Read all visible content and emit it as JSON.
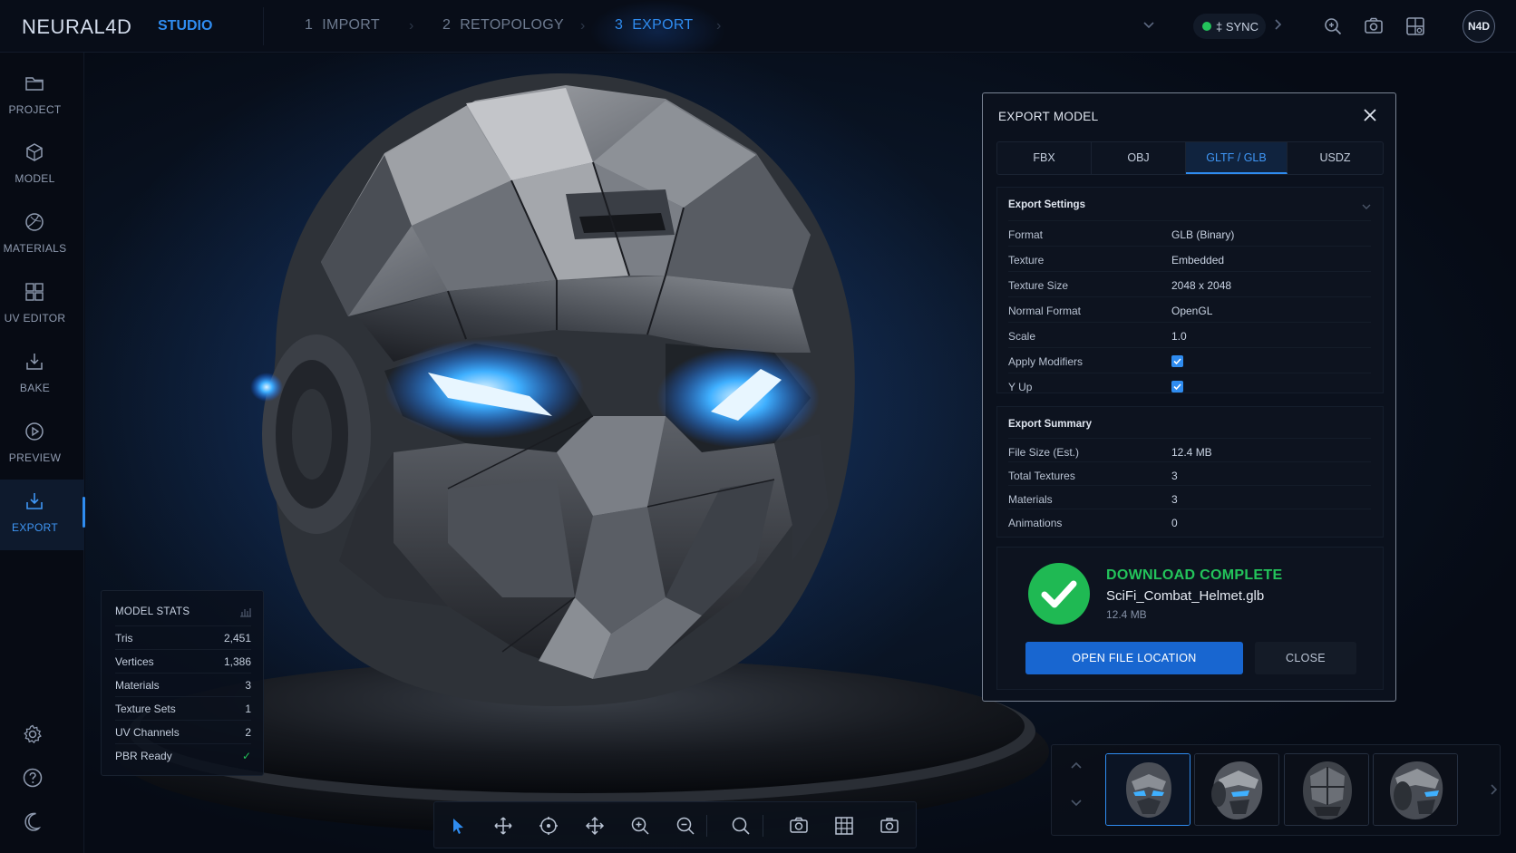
{
  "app": {
    "logo": "NEURAL4D",
    "workspace": "STUDIO"
  },
  "steps": [
    {
      "num": "1",
      "label": "IMPORT",
      "active": false
    },
    {
      "num": "2",
      "label": "RETOPOLOGY",
      "active": false
    },
    {
      "num": "3",
      "label": "EXPORT",
      "active": true
    }
  ],
  "topbar": {
    "sync_label": "‡ SYNC",
    "avatar_initials": "N4D",
    "icons": [
      "chevron-down-icon",
      "chevron-right-icon",
      "search-zoom-icon",
      "camera-icon",
      "layout-icon"
    ]
  },
  "sidebar": {
    "items": [
      {
        "label": "PROJECT",
        "icon": "folder-icon"
      },
      {
        "label": "MODEL",
        "icon": "cube-icon"
      },
      {
        "label": "MATERIALS",
        "icon": "material-sphere-icon"
      },
      {
        "label": "UV EDITOR",
        "icon": "uv-grid-icon"
      },
      {
        "label": "BAKE",
        "icon": "bake-icon"
      },
      {
        "label": "PREVIEW",
        "icon": "play-icon"
      },
      {
        "label": "EXPORT",
        "icon": "export-icon",
        "active": true
      }
    ],
    "bottom_icons": [
      "settings-icon",
      "help-icon",
      "theme-moon-icon"
    ]
  },
  "model_stats": {
    "title": "MODEL STATS",
    "rows": [
      {
        "label": "Tris",
        "value": "2,451"
      },
      {
        "label": "Vertices",
        "value": "1,386"
      },
      {
        "label": "Materials",
        "value": "3"
      },
      {
        "label": "Texture Sets",
        "value": "1"
      },
      {
        "label": "UV Channels",
        "value": "2"
      },
      {
        "label": "PBR Ready",
        "value": "✓"
      }
    ]
  },
  "export_modal": {
    "title": "EXPORT MODEL",
    "tabs": [
      {
        "label": "FBX",
        "active": false
      },
      {
        "label": "OBJ",
        "active": false
      },
      {
        "label": "GLTF / GLB",
        "active": true
      },
      {
        "label": "USDZ",
        "active": false
      }
    ],
    "settings": {
      "title": "Export Settings",
      "rows": [
        {
          "label": "Format",
          "value": "GLB (Binary)"
        },
        {
          "label": "Texture",
          "value": "Embedded"
        },
        {
          "label": "Texture Size",
          "value": "2048 x 2048"
        },
        {
          "label": "Normal Format",
          "value": "OpenGL"
        },
        {
          "label": "Scale",
          "value": "1.0"
        },
        {
          "label": "Apply Modifiers",
          "checked": true
        },
        {
          "label": "Y Up",
          "checked": true
        }
      ]
    },
    "summary": {
      "title": "Export Summary",
      "rows": [
        {
          "label": "File Size (Est.)",
          "value": "12.4 MB"
        },
        {
          "label": "Total Textures",
          "value": "3"
        },
        {
          "label": "Materials",
          "value": "3"
        },
        {
          "label": "Animations",
          "value": "0"
        }
      ]
    },
    "download": {
      "status": "DOWNLOAD COMPLETE",
      "file_name": "SciFi_Combat_Helmet.glb",
      "file_size": "12.4 MB",
      "open_label": "OPEN FILE LOCATION",
      "close_label": "CLOSE"
    }
  },
  "thumbnails": {
    "count": 4,
    "selected_index": 0
  },
  "toolbar": {
    "tools": [
      "select-cursor-icon",
      "move-icon",
      "rotate-icon",
      "pan-icon",
      "zoom-in-icon",
      "zoom-out-icon",
      "search-icon",
      "screenshot-icon",
      "grid-icon",
      "camera-icon"
    ]
  },
  "colors": {
    "accent": "#2f8cf0",
    "success": "#23c45b",
    "glow": "#29a4ff",
    "background": "#070c16"
  }
}
